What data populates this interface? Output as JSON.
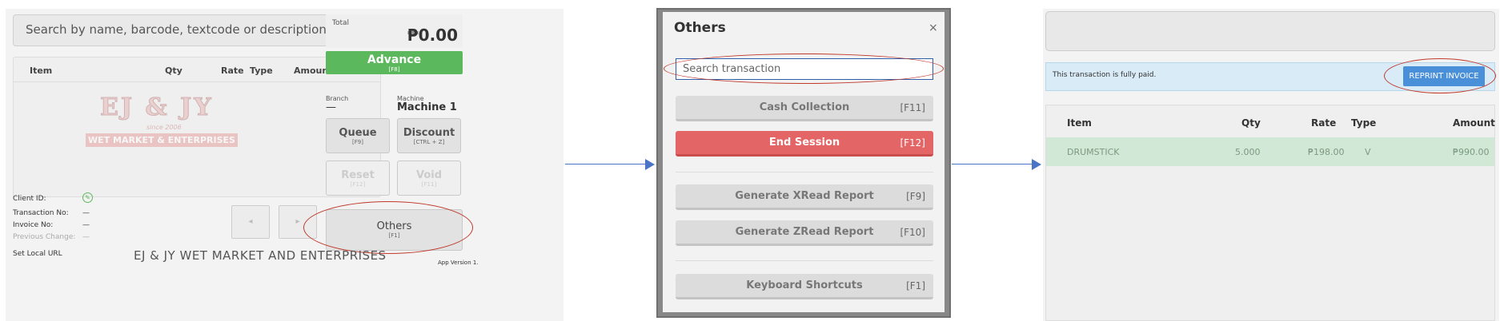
{
  "panel1": {
    "search_placeholder": "Search by name, barcode, textcode or description",
    "columns": [
      "Item",
      "Qty",
      "Rate",
      "Type",
      "Amount"
    ],
    "logo": {
      "main": "EJ & JY",
      "since": "since 2006",
      "ribbon": "WET MARKET & ENTERPRISES"
    },
    "total_label": "Total",
    "total_value": "₱0.00",
    "advance_label": "Advance",
    "advance_key": "[F8]",
    "branch_label": "Branch",
    "branch_value": "—",
    "machine_label": "Machine",
    "machine_value": "Machine 1",
    "queue_label": "Queue",
    "queue_key": "[F9]",
    "discount_label": "Discount",
    "discount_key": "[CTRL + Z]",
    "reset_label": "Reset",
    "reset_key": "[F12]",
    "void_label": "Void",
    "void_key": "[F11]",
    "client_id_label": "Client ID:",
    "transaction_no_label": "Transaction No:",
    "transaction_no_value": "—",
    "invoice_no_label": "Invoice No:",
    "invoice_no_value": "—",
    "previous_change_label": "Previous Change:",
    "previous_change_value": "—",
    "prev_glyph": "◂",
    "next_glyph": "▸",
    "others_label": "Others",
    "others_key": "[F1]",
    "set_local_url": "Set Local URL",
    "store_name": "EJ & JY WET MARKET AND ENTERPRISES",
    "app_version": "App Version 1."
  },
  "modal": {
    "title": "Others",
    "close": "×",
    "search_placeholder": "Search transaction",
    "buttons": [
      {
        "label": "Cash Collection",
        "key": "[F11]"
      },
      {
        "label": "End Session",
        "key": "[F12]"
      },
      {
        "label": "Generate XRead Report",
        "key": "[F9]"
      },
      {
        "label": "Generate ZRead Report",
        "key": "[F10]"
      },
      {
        "label": "Keyboard Shortcuts",
        "key": "[F1]"
      }
    ]
  },
  "panel3": {
    "paid_message": "This transaction is fully paid.",
    "reprint_label": "REPRINT INVOICE",
    "columns": [
      "Item",
      "Qty",
      "Rate",
      "Type",
      "Amount"
    ],
    "row": {
      "item": "DRUMSTICK",
      "qty": "5.000",
      "rate": "₱198.00",
      "type": "V",
      "amount": "₱990.00"
    }
  },
  "colors": {
    "advance": "#5cb85c",
    "end_session": "#e46565",
    "reprint": "#4a90d9",
    "highlight": "#c0392b",
    "arrow": "#4a74c5"
  }
}
